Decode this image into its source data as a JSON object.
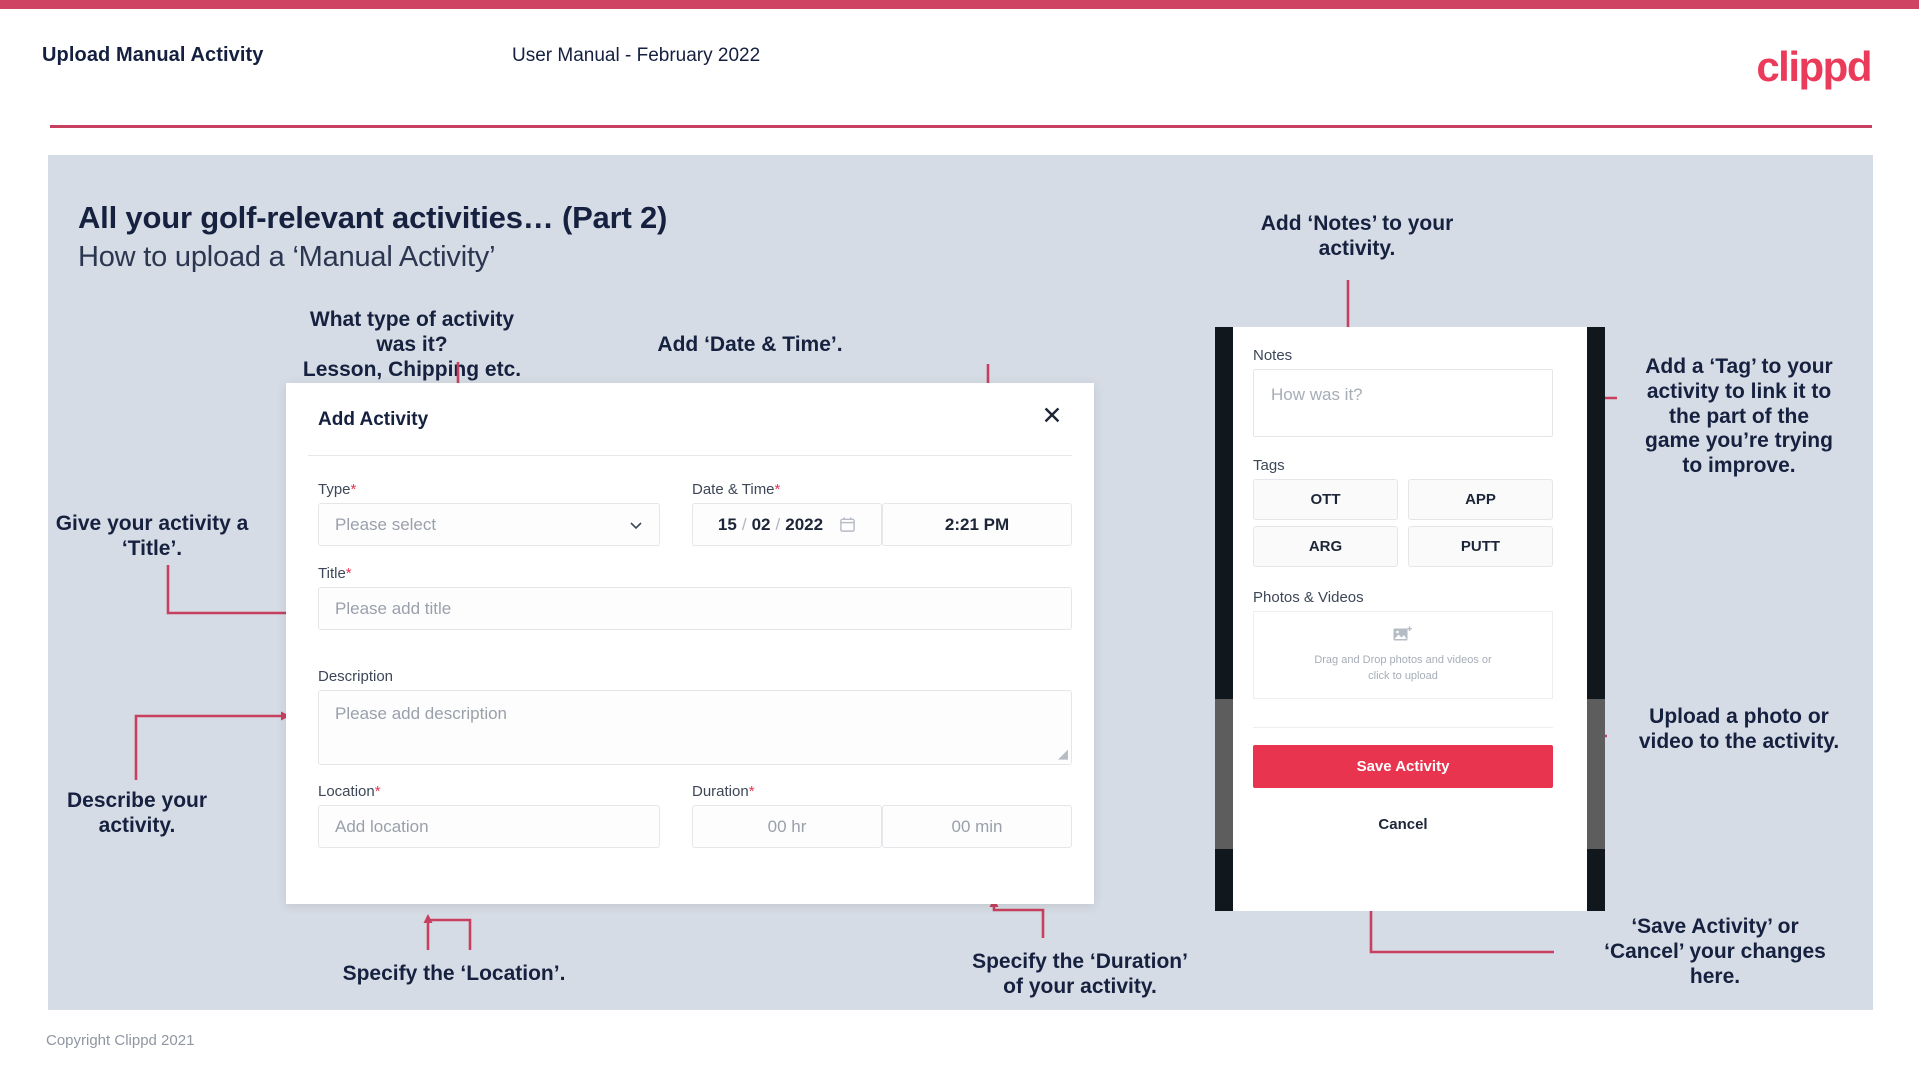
{
  "header": {
    "left_title": "Upload Manual Activity",
    "center_title": "User Manual - February 2022",
    "logo": "clippd"
  },
  "slide": {
    "title": "All your golf-relevant activities… (Part 2)",
    "subtitle": "How to upload a ‘Manual Activity’"
  },
  "annotations": {
    "type": "What type of activity was it?\nLesson, Chipping etc.",
    "datetime": "Add ‘Date & Time’.",
    "title": "Give your activity a\n‘Title’.",
    "description": "Describe your\nactivity.",
    "location": "Specify the ‘Location’.",
    "duration": "Specify the ‘Duration’\nof your activity.",
    "notes": "Add ‘Notes’ to your\nactivity.",
    "tags": "Add a ‘Tag’ to your\nactivity to link it to\nthe part of the\ngame you’re trying\nto improve.",
    "upload": "Upload a photo or\nvideo to the activity.",
    "save": "‘Save Activity’ or\n‘Cancel’ your changes\nhere."
  },
  "dialog": {
    "title": "Add Activity",
    "close_icon": "close-icon",
    "fields": {
      "type": {
        "label": "Type",
        "required": "*",
        "placeholder": "Please select"
      },
      "datetime": {
        "label": "Date & Time",
        "required": "*",
        "day": "15",
        "sep1": "/",
        "month": "02",
        "sep2": "/",
        "year": "2022",
        "time": "2:21 PM"
      },
      "title": {
        "label": "Title",
        "required": "*",
        "placeholder": "Please add title"
      },
      "description": {
        "label": "Description",
        "required": "",
        "placeholder": "Please add description"
      },
      "location": {
        "label": "Location",
        "required": "*",
        "placeholder": "Add location"
      },
      "duration": {
        "label": "Duration",
        "required": "*",
        "hours": "00 hr",
        "minutes": "00 min"
      }
    }
  },
  "phone": {
    "notes_label": "Notes",
    "notes_placeholder": "How was it?",
    "tags_label": "Tags",
    "tags": [
      "OTT",
      "APP",
      "ARG",
      "PUTT"
    ],
    "photos_label": "Photos & Videos",
    "drop_line1": "Drag and Drop photos and videos or",
    "drop_line2": "click to upload",
    "save_label": "Save Activity",
    "cancel_label": "Cancel"
  },
  "footer": {
    "copyright": "Copyright Clippd 2021"
  },
  "colors": {
    "accent": "#cf4462",
    "brand": "#eb3b5a",
    "save": "#e8344e",
    "slide_bg": "#d6dce5",
    "text": "#15213f",
    "connector": "#c8405f"
  }
}
